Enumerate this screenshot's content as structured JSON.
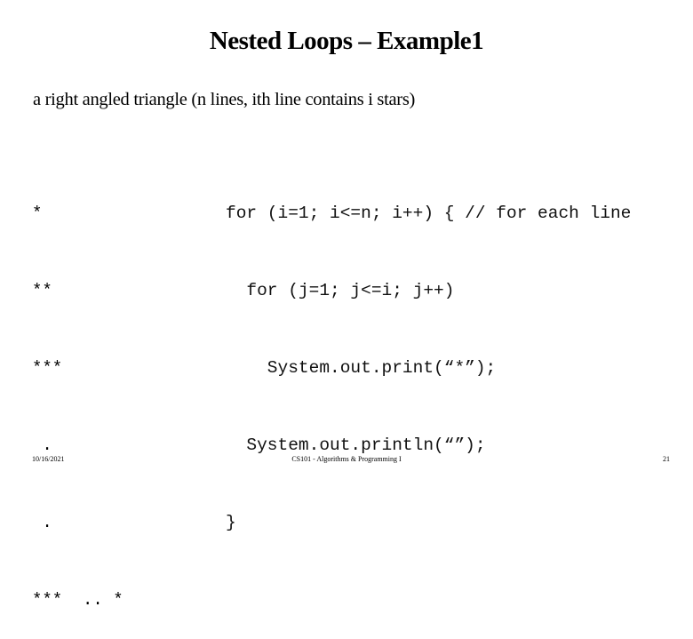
{
  "slide": {
    "title": "Nested Loops – Example1",
    "subtitle": "a right angled triangle (n lines, ith line contains i stars)",
    "pattern_lines": [
      "*",
      "**",
      "***",
      " .",
      " .",
      "***  .. *"
    ],
    "code_lines": [
      "for (i=1; i<=n; i++) { // for each line",
      "  for (j=1; j<=i; j++)",
      "    System.out.print(“*”);",
      "  System.out.println(“”);",
      "}"
    ]
  },
  "footer": {
    "date": "10/16/2021",
    "course": "CS101 - Algorithms & Programming I",
    "page": "21"
  }
}
